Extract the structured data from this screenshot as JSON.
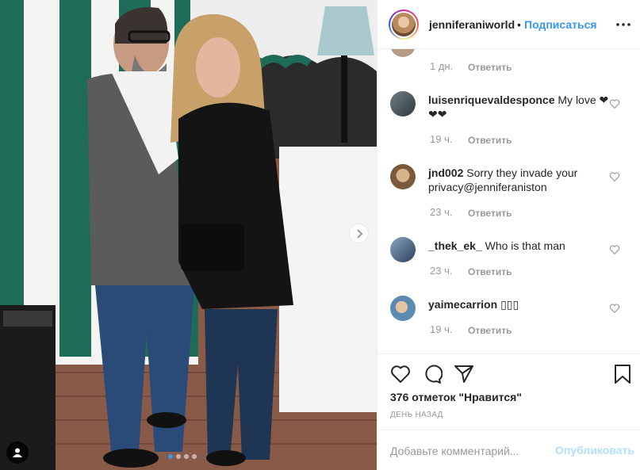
{
  "header": {
    "username": "jenniferaniworld",
    "separator": "•",
    "follow_label": "Подписаться"
  },
  "comments": [
    {
      "username": "",
      "text": "",
      "time": "1 дн.",
      "reply_label": "Ответить"
    },
    {
      "username": "luisenriquevaldesponce",
      "text": "My love ❤❤❤",
      "time": "19 ч.",
      "reply_label": "Ответить"
    },
    {
      "username": "jnd002",
      "text": "Sorry they invade your privacy@jenniferaniston",
      "time": "23 ч.",
      "reply_label": "Ответить"
    },
    {
      "username": "_thek_ek_",
      "text": "Who is that man",
      "time": "23 ч.",
      "reply_label": "Ответить"
    },
    {
      "username": "yaimecarrion",
      "text": "▯▯▯",
      "time": "19 ч.",
      "reply_label": "Ответить"
    }
  ],
  "footer": {
    "likes": "376 отметок \"Нравится\"",
    "posted": "ДЕНЬ НАЗАД",
    "comment_placeholder": "Добавьте комментарий...",
    "post_label": "Опубликовать"
  },
  "carousel": {
    "slides": 4,
    "active_index": 0
  },
  "colors": {
    "accent": "#3897f0",
    "muted": "#999999",
    "post_disabled": "#b2dffc",
    "text": "#262626"
  },
  "icons": [
    "heart-icon",
    "comment-icon",
    "share-icon",
    "bookmark-icon",
    "more-options-icon",
    "chevron-right-icon",
    "user-tag-icon"
  ]
}
